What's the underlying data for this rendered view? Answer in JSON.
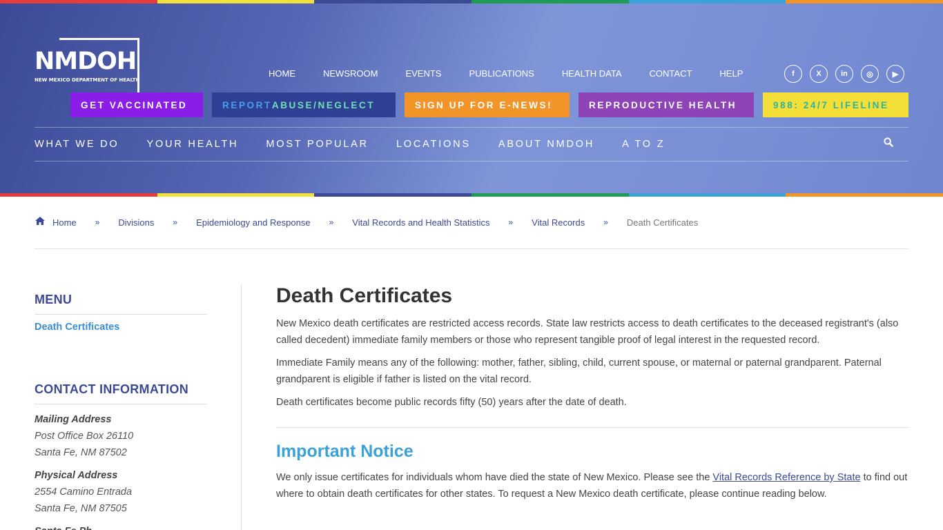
{
  "rainbow_colors": [
    "#e63c3c",
    "#f4e03a",
    "#3c4a96",
    "#1e9c55",
    "#3aa2d6",
    "#f29427"
  ],
  "logo": {
    "wordmark": "NMDOH",
    "subtitle": "NEW MEXICO DEPARTMENT OF HEALTH"
  },
  "topnav": [
    "HOME",
    "NEWSROOM",
    "EVENTS",
    "PUBLICATIONS",
    "HEALTH DATA",
    "CONTACT",
    "HELP"
  ],
  "social": [
    {
      "icon": "facebook-icon",
      "glyph": "f"
    },
    {
      "icon": "x-twitter-icon",
      "glyph": "X"
    },
    {
      "icon": "linkedin-icon",
      "glyph": "in"
    },
    {
      "icon": "instagram-icon",
      "glyph": "◎"
    },
    {
      "icon": "youtube-icon",
      "glyph": "▶"
    }
  ],
  "promo_buttons": {
    "vaccinated": "GET VACCINATED",
    "abuse_a": "REPORT ",
    "abuse_b": "ABUSE/NEGLECT",
    "enews": "SIGN UP FOR E-NEWS!",
    "repro": "REPRODUCTIVE HEALTH",
    "lifeline": "988: 24/7 LIFELINE"
  },
  "mainnav": [
    "WHAT WE DO",
    "YOUR HEALTH",
    "MOST POPULAR",
    "LOCATIONS",
    "ABOUT NMDOH",
    "A TO Z"
  ],
  "breadcrumb": {
    "items": [
      "Home",
      "Divisions",
      "Epidemiology and Response",
      "Vital Records and Health Statistics",
      "Vital Records"
    ],
    "current": "Death Certificates"
  },
  "sidebar": {
    "menu_title": "MENU",
    "menu_link": "Death Certificates",
    "contact_title": "CONTACT INFORMATION",
    "mailing": {
      "label": "Mailing Address",
      "line1": "Post Office Box 26110",
      "line2": "Santa Fe, NM 87502"
    },
    "physical": {
      "label": "Physical Address",
      "line1": "2554 Camino Entrada",
      "line2": "Santa Fe, NM 87505"
    },
    "next_label": "Santa Fe Ph..."
  },
  "content": {
    "title": "Death Certificates",
    "p1": "New Mexico death certificates are restricted access records. State law restricts access to death certificates to the deceased registrant's (also called decedent) immediate family members or those who represent tangible proof of legal interest in the requested record.",
    "p2": "Immediate Family means any of the following: mother, father, sibling, child, current spouse, or maternal or paternal grandparent. Paternal grandparent is eligible if father is listed on the vital record.",
    "p3": "Death certificates become public records fifty (50) years after the date of death.",
    "notice_title": "Important Notice",
    "notice_pre": "We only issue certificates for individuals whom have died the state of New Mexico. Please see the ",
    "notice_link": "Vital Records Reference by State",
    "notice_post": " to find out where to obtain death certificates for other states. To request a New Mexico death certificate, please continue reading below."
  }
}
